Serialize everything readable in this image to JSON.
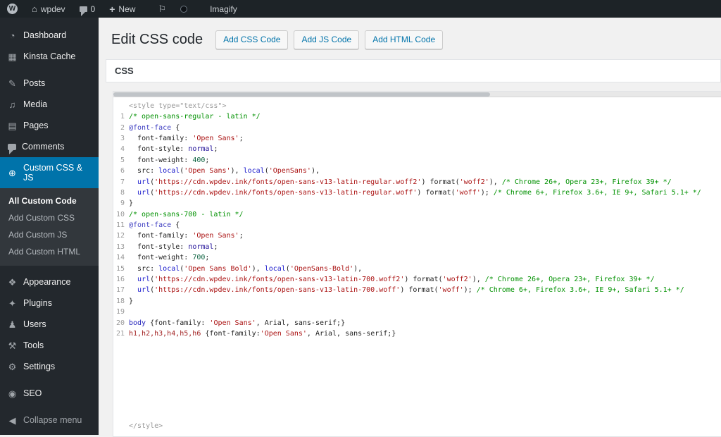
{
  "colors": {
    "admin_bar_bg": "#1d2327",
    "sidebar_bg": "#23282d",
    "submenu_bg": "#32373c",
    "active_blue": "#0073aa",
    "link_blue": "#0073aa",
    "content_bg": "#f1f1f1"
  },
  "admin_bar": {
    "wp_logo_letter": "W",
    "home_icon_glyph": "⌂",
    "site_name": "wpdev",
    "comments_count": "0",
    "new_plus_glyph": "+",
    "new_label": "New",
    "flag_icon_glyph": "⚐",
    "imagify_label": "Imagify"
  },
  "sidebar": {
    "items": [
      {
        "id": "dashboard",
        "label": "Dashboard",
        "icon": "◔",
        "icon_name": "dashboard-gauge-icon"
      },
      {
        "id": "kinsta-cache",
        "label": "Kinsta Cache",
        "icon": "▦",
        "icon_name": "cache-icon"
      },
      {
        "type": "separator"
      },
      {
        "id": "posts",
        "label": "Posts",
        "icon": "✎",
        "icon_name": "posts-pin-icon"
      },
      {
        "id": "media",
        "label": "Media",
        "icon": "♫",
        "icon_name": "media-note-icon"
      },
      {
        "id": "pages",
        "label": "Pages",
        "icon": "▤",
        "icon_name": "pages-icon"
      },
      {
        "id": "comments",
        "label": "Comments",
        "icon": "bubble",
        "icon_name": "comments-bubble-icon"
      },
      {
        "id": "custom-css-js",
        "label": "Custom CSS & JS",
        "icon": "⊕",
        "icon_name": "plus-circle-icon",
        "active": true,
        "submenu": [
          {
            "id": "all-custom-code",
            "label": "All Custom Code",
            "active": true
          },
          {
            "id": "add-custom-css",
            "label": "Add Custom CSS"
          },
          {
            "id": "add-custom-js",
            "label": "Add Custom JS"
          },
          {
            "id": "add-custom-html",
            "label": "Add Custom HTML"
          }
        ]
      },
      {
        "type": "separator"
      },
      {
        "id": "appearance",
        "label": "Appearance",
        "icon": "❖",
        "icon_name": "appearance-brush-icon"
      },
      {
        "id": "plugins",
        "label": "Plugins",
        "icon": "✦",
        "icon_name": "plugins-plug-icon"
      },
      {
        "id": "users",
        "label": "Users",
        "icon": "♟",
        "icon_name": "users-person-icon"
      },
      {
        "id": "tools",
        "label": "Tools",
        "icon": "⚒",
        "icon_name": "tools-wrench-icon"
      },
      {
        "id": "settings",
        "label": "Settings",
        "icon": "⚙",
        "icon_name": "settings-sliders-icon"
      },
      {
        "type": "separator"
      },
      {
        "id": "seo",
        "label": "SEO",
        "icon": "◉",
        "icon_name": "seo-icon"
      },
      {
        "type": "separator"
      },
      {
        "id": "collapse-menu",
        "label": "Collapse menu",
        "icon": "◀",
        "icon_name": "collapse-arrow-icon",
        "dim": true
      }
    ]
  },
  "page": {
    "title": "Edit CSS code",
    "buttons": [
      {
        "id": "css",
        "label": "Add CSS Code"
      },
      {
        "id": "js",
        "label": "Add JS Code"
      },
      {
        "id": "html",
        "label": "Add HTML Code"
      }
    ]
  },
  "panel": {
    "header": "CSS"
  },
  "editor": {
    "pre": "<style type=\"text/css\">",
    "post": "</style>",
    "token_colors": {
      "meta": "#999999",
      "com": "#009100",
      "str": "#aa1111",
      "def": "#4040c2",
      "prop": "#222222",
      "atom": "#221199",
      "num": "#116644",
      "fn": "#1a1acc",
      "pln": "#1f1f1f",
      "tag": "#2222bb",
      "tag2": "#a22222"
    },
    "lines": [
      [
        [
          "com",
          "/* open-sans-regular - latin */"
        ]
      ],
      [
        [
          "def",
          "@font-face"
        ],
        [
          "pln",
          " {"
        ]
      ],
      [
        [
          "pln",
          "  "
        ],
        [
          "prop",
          "font-family"
        ],
        [
          "pln",
          ": "
        ],
        [
          "str",
          "'Open Sans'"
        ],
        [
          "pln",
          ";"
        ]
      ],
      [
        [
          "pln",
          "  "
        ],
        [
          "prop",
          "font-style"
        ],
        [
          "pln",
          ": "
        ],
        [
          "atom",
          "normal"
        ],
        [
          "pln",
          ";"
        ]
      ],
      [
        [
          "pln",
          "  "
        ],
        [
          "prop",
          "font-weight"
        ],
        [
          "pln",
          ": "
        ],
        [
          "num",
          "400"
        ],
        [
          "pln",
          ";"
        ]
      ],
      [
        [
          "pln",
          "  "
        ],
        [
          "prop",
          "src"
        ],
        [
          "pln",
          ": "
        ],
        [
          "fn",
          "local"
        ],
        [
          "pln",
          "("
        ],
        [
          "str",
          "'Open Sans'"
        ],
        [
          "pln",
          "), "
        ],
        [
          "fn",
          "local"
        ],
        [
          "pln",
          "("
        ],
        [
          "str",
          "'OpenSans'"
        ],
        [
          "pln",
          "),"
        ]
      ],
      [
        [
          "pln",
          "  "
        ],
        [
          "fn",
          "url"
        ],
        [
          "pln",
          "("
        ],
        [
          "str",
          "'https://cdn.wpdev.ink/fonts/open-sans-v13-latin-regular.woff2'"
        ],
        [
          "pln",
          ") format("
        ],
        [
          "str",
          "'woff2'"
        ],
        [
          "pln",
          "), "
        ],
        [
          "com",
          "/* Chrome 26+, Opera 23+, Firefox 39+ */"
        ]
      ],
      [
        [
          "pln",
          "  "
        ],
        [
          "fn",
          "url"
        ],
        [
          "pln",
          "("
        ],
        [
          "str",
          "'https://cdn.wpdev.ink/fonts/open-sans-v13-latin-regular.woff'"
        ],
        [
          "pln",
          ") format("
        ],
        [
          "str",
          "'woff'"
        ],
        [
          "pln",
          "); "
        ],
        [
          "com",
          "/* Chrome 6+, Firefox 3.6+, IE 9+, Safari 5.1+ */"
        ]
      ],
      [
        [
          "pln",
          "}"
        ]
      ],
      [
        [
          "com",
          "/* open-sans-700 - latin */"
        ]
      ],
      [
        [
          "def",
          "@font-face"
        ],
        [
          "pln",
          " {"
        ]
      ],
      [
        [
          "pln",
          "  "
        ],
        [
          "prop",
          "font-family"
        ],
        [
          "pln",
          ": "
        ],
        [
          "str",
          "'Open Sans'"
        ],
        [
          "pln",
          ";"
        ]
      ],
      [
        [
          "pln",
          "  "
        ],
        [
          "prop",
          "font-style"
        ],
        [
          "pln",
          ": "
        ],
        [
          "atom",
          "normal"
        ],
        [
          "pln",
          ";"
        ]
      ],
      [
        [
          "pln",
          "  "
        ],
        [
          "prop",
          "font-weight"
        ],
        [
          "pln",
          ": "
        ],
        [
          "num",
          "700"
        ],
        [
          "pln",
          ";"
        ]
      ],
      [
        [
          "pln",
          "  "
        ],
        [
          "prop",
          "src"
        ],
        [
          "pln",
          ": "
        ],
        [
          "fn",
          "local"
        ],
        [
          "pln",
          "("
        ],
        [
          "str",
          "'Open Sans Bold'"
        ],
        [
          "pln",
          "), "
        ],
        [
          "fn",
          "local"
        ],
        [
          "pln",
          "("
        ],
        [
          "str",
          "'OpenSans-Bold'"
        ],
        [
          "pln",
          "),"
        ]
      ],
      [
        [
          "pln",
          "  "
        ],
        [
          "fn",
          "url"
        ],
        [
          "pln",
          "("
        ],
        [
          "str",
          "'https://cdn.wpdev.ink/fonts/open-sans-v13-latin-700.woff2'"
        ],
        [
          "pln",
          ") format("
        ],
        [
          "str",
          "'woff2'"
        ],
        [
          "pln",
          "), "
        ],
        [
          "com",
          "/* Chrome 26+, Opera 23+, Firefox 39+ */"
        ]
      ],
      [
        [
          "pln",
          "  "
        ],
        [
          "fn",
          "url"
        ],
        [
          "pln",
          "("
        ],
        [
          "str",
          "'https://cdn.wpdev.ink/fonts/open-sans-v13-latin-700.woff'"
        ],
        [
          "pln",
          ") format("
        ],
        [
          "str",
          "'woff'"
        ],
        [
          "pln",
          "); "
        ],
        [
          "com",
          "/* Chrome 6+, Firefox 3.6+, IE 9+, Safari 5.1+ */"
        ]
      ],
      [
        [
          "pln",
          "}"
        ]
      ],
      [],
      [
        [
          "tag",
          "body"
        ],
        [
          "pln",
          " {"
        ],
        [
          "prop",
          "font-family"
        ],
        [
          "pln",
          ": "
        ],
        [
          "str",
          "'Open Sans'"
        ],
        [
          "pln",
          ", Arial, sans-serif;}"
        ]
      ],
      [
        [
          "tag2",
          "h1,h2,h3,h4,h5,h6"
        ],
        [
          "pln",
          " {"
        ],
        [
          "prop",
          "font-family"
        ],
        [
          "pln",
          ":"
        ],
        [
          "str",
          "'Open Sans'"
        ],
        [
          "pln",
          ", Arial, sans-serif;}"
        ]
      ]
    ]
  }
}
